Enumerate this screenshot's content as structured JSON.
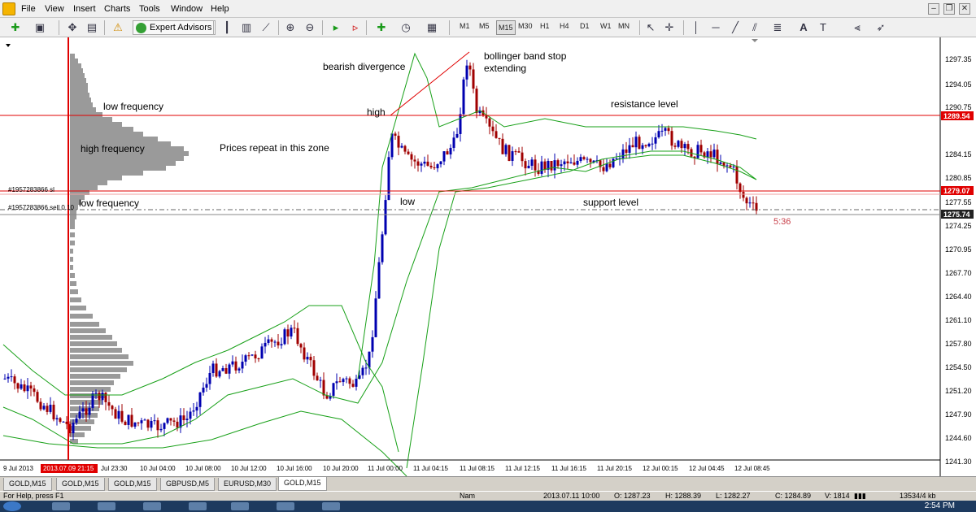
{
  "menubar": {
    "items": [
      "File",
      "View",
      "Insert",
      "Charts",
      "Tools",
      "Window",
      "Help"
    ]
  },
  "toolbar": {
    "expert_advisors_label": "Expert Advisors",
    "timeframes": [
      "M1",
      "M5",
      "M15",
      "M30",
      "H1",
      "H4",
      "D1",
      "W1",
      "MN"
    ],
    "active_timeframe": "M15"
  },
  "price_axis": {
    "labels": [
      "1297.35",
      "1294.05",
      "1290.75",
      "1284.15",
      "1280.85",
      "1277.55",
      "1274.25",
      "1270.95",
      "1267.70",
      "1264.40",
      "1261.10",
      "1257.80",
      "1254.50",
      "1251.20",
      "1247.90",
      "1244.60",
      "1241.30"
    ],
    "highlight_red": [
      "1289.54",
      "1279.07"
    ],
    "highlight_dark": "1275.74"
  },
  "time_axis": {
    "labels": [
      "9 Jul 2013",
      "2013.07.09 21:15",
      "Jul 23:30",
      "10 Jul 04:00",
      "10 Jul 08:00",
      "10 Jul 12:00",
      "10 Jul 16:00",
      "10 Jul 20:00",
      "11 Jul 00:00",
      "11 Jul 04:15",
      "11 Jul 08:15",
      "11 Jul 12:15",
      "11 Jul 16:15",
      "11 Jul 20:15",
      "12 Jul 00:15",
      "12 Jul 04:45",
      "12 Jul 08:45"
    ]
  },
  "annotations": {
    "bearish": "bearish divergence",
    "bollinger_1": "bollinger band stop",
    "bollinger_2": "extending",
    "low_freq_top": "low frequency",
    "high_label": "high",
    "resistance": "resistance level",
    "high_freq": "high frequency",
    "prices_repeat": "Prices repeat in this zone",
    "low_freq_mid": "low frequency",
    "low_label": "low",
    "support": "support level",
    "order_sl": "#1957283866 sl",
    "order_sell": "#1957283866 sell 0.10",
    "countdown": "5:36"
  },
  "chart_tabs": [
    "GOLD,M15",
    "GOLD,M15",
    "GOLD,M15",
    "GBPUSD,M5",
    "EURUSD,M30",
    "GOLD,M15"
  ],
  "active_tab_index": 5,
  "status": {
    "help": "For Help, press F1",
    "name": "Nam",
    "time": "2013.07.11 10:00",
    "open": "O: 1287.23",
    "high": "H: 1288.39",
    "low": "L: 1282.27",
    "close": "C: 1284.89",
    "volume": "V: 1814",
    "traffic": "13534/4 kb"
  },
  "taskbar": {
    "clock": "2:54 PM"
  },
  "colors": {
    "bull": "#0000b0",
    "bear": "#a00000",
    "bollinger": "#18a018",
    "red_line": "#e00000",
    "profile": "#9a9a9a"
  }
}
